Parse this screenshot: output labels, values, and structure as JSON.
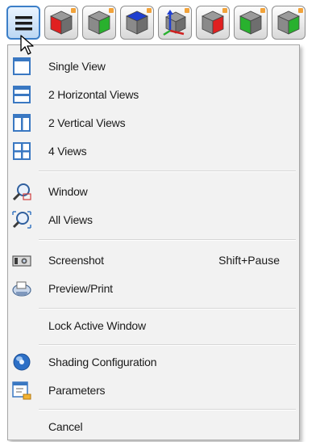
{
  "toolbar": {
    "buttons": [
      {
        "icon": "hamburger-menu-icon"
      },
      {
        "icon": "cube-red-front-icon",
        "face": "#e02020"
      },
      {
        "icon": "cube-green-side-icon",
        "face": "#29b12e"
      },
      {
        "icon": "cube-blue-top-icon",
        "face": "#1f3fcf"
      },
      {
        "icon": "cube-axes-icon"
      },
      {
        "icon": "cube-red-left-icon",
        "face": "#e02020"
      },
      {
        "icon": "cube-green-right-icon",
        "face": "#29b12e"
      }
    ]
  },
  "menu": {
    "items": [
      {
        "label": "Single View",
        "icon": "single-view-icon"
      },
      {
        "label": "2 Horizontal Views",
        "icon": "two-horizontal-views-icon"
      },
      {
        "label": "2 Vertical Views",
        "icon": "two-vertical-views-icon"
      },
      {
        "label": "4 Views",
        "icon": "four-views-icon"
      },
      {
        "label": "Window",
        "icon": "zoom-window-icon"
      },
      {
        "label": "All Views",
        "icon": "zoom-all-views-icon"
      },
      {
        "label": "Screenshot",
        "shortcut": "Shift+Pause",
        "icon": "camera-icon"
      },
      {
        "label": "Preview/Print",
        "icon": "printer-icon"
      },
      {
        "label": "Lock Active Window"
      },
      {
        "label": "Shading Configuration",
        "icon": "shading-sphere-icon"
      },
      {
        "label": "Parameters",
        "icon": "parameters-icon"
      },
      {
        "label": "Cancel"
      }
    ]
  },
  "colors": {
    "accent": "#3c7fc8",
    "menu_background": "#f2f2f2"
  }
}
